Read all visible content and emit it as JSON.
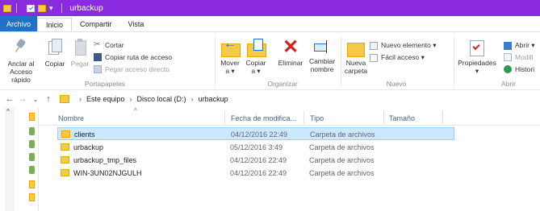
{
  "window": {
    "title": "urbackup"
  },
  "tabs": [
    "Archivo",
    "Inicio",
    "Compartir",
    "Vista"
  ],
  "ribbon": {
    "portapapeles": {
      "pin": "Anclar al\nAcceso rápido",
      "copy": "Copiar",
      "paste": "Pegar",
      "cut": "Cortar",
      "copy_path": "Copiar ruta de acceso",
      "paste_shortcut": "Pegar acceso directo",
      "label": "Portapapeles"
    },
    "organizar": {
      "move": "Mover\na ▾",
      "copy_to": "Copiar\na ▾",
      "delete": "Eliminar",
      "rename": "Cambiar\nnombre",
      "label": "Organizar"
    },
    "nuevo": {
      "new_folder": "Nueva\ncarpeta",
      "new_item": "Nuevo elemento ▾",
      "easy_access": "Fácil acceso ▾",
      "label": "Nuevo"
    },
    "abrir": {
      "properties": "Propiedades",
      "open": "Abrir ▾",
      "modify": "Modifi",
      "history": "Histori",
      "label": "Abrir"
    }
  },
  "address": {
    "crumbs": [
      "Este equipo",
      "Disco local (D:)",
      "urbackup"
    ]
  },
  "columns": {
    "name": "Nombre",
    "date": "Fecha de modifica...",
    "type": "Tipo",
    "size": "Tamaño"
  },
  "files": [
    {
      "name": "clients",
      "date": "04/12/2016 22:49",
      "type": "Carpeta de archivos"
    },
    {
      "name": "urbackup",
      "date": "05/12/2016 3:49",
      "type": "Carpeta de archivos"
    },
    {
      "name": "urbackup_tmp_files",
      "date": "04/12/2016 22:49",
      "type": "Carpeta de archivos"
    },
    {
      "name": "WIN-3UN02NJGULH",
      "date": "04/12/2016 22:49",
      "type": "Carpeta de archivos"
    }
  ]
}
